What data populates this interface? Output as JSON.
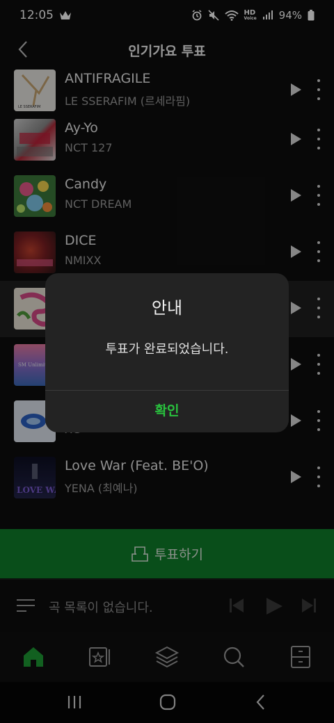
{
  "status": {
    "time": "12:05",
    "battery": "94%",
    "hd_top": "HD",
    "hd_bottom": "Voice"
  },
  "header": {
    "title": "인기가요 투표"
  },
  "songs": [
    {
      "title": "ANTIFRAGILE",
      "artist": "LE SSERAFIM (르세라핌)",
      "art_text": "LE SSERAFIM"
    },
    {
      "title": "Ay-Yo",
      "artist": "NCT 127"
    },
    {
      "title": "Candy",
      "artist": "NCT DREAM"
    },
    {
      "title": "DICE",
      "artist": "NMIXX"
    },
    {
      "title": "",
      "artist": ""
    },
    {
      "title": "",
      "artist": "",
      "art_text": "SM Unlimited Soun"
    },
    {
      "title": "",
      "artist": "XG"
    },
    {
      "title": "Love War (Feat. BE'O)",
      "artist": "YENA (최예나)",
      "art_text": "LOVE WAR"
    }
  ],
  "vote": {
    "label": "투표하기"
  },
  "player": {
    "empty_text": "곡 목록이 없습니다."
  },
  "nav": [
    "home-icon",
    "my-library-icon",
    "layers-icon",
    "search-icon",
    "storage-icon"
  ],
  "dialog": {
    "title": "안내",
    "message": "투표가 완료되었습니다.",
    "confirm": "확인"
  },
  "colors": {
    "accent": "#29c33e",
    "vote_bar": "#0f7f2a",
    "background": "#0e0e0e",
    "dialog": "#232323"
  }
}
